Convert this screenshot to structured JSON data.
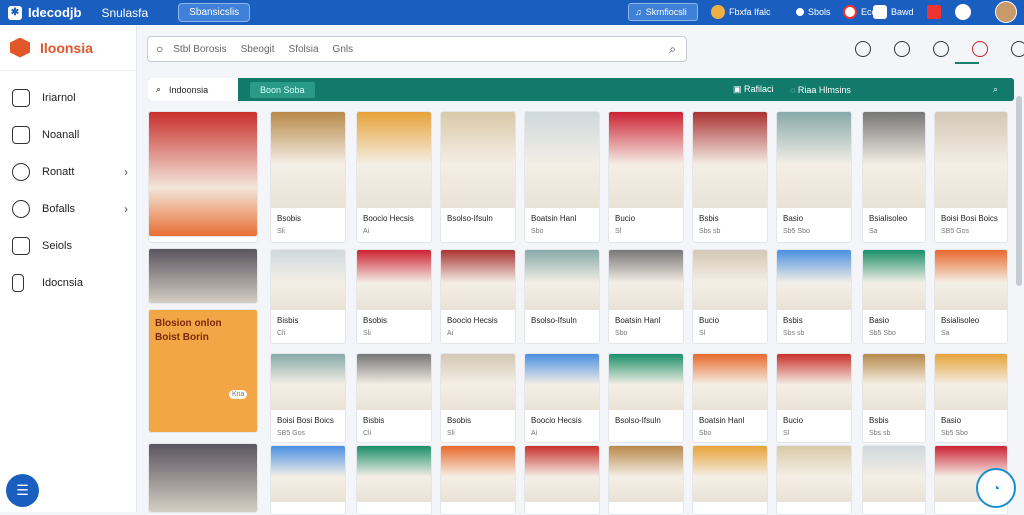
{
  "topbar": {
    "brand": "Idecodjb",
    "nav1": "Snulasfa",
    "pill": "Sbansicslis",
    "music": "Skrnfiocsli",
    "items": [
      "Fbxfa Ifalc",
      "Sbols",
      "Ecco",
      "Bawd"
    ]
  },
  "sidebar": {
    "shop_name": "Iloonsia",
    "items": [
      {
        "label": "Iriarnol",
        "icon": "route-icon",
        "chev": false
      },
      {
        "label": "Noanall",
        "icon": "chart-icon",
        "chev": false
      },
      {
        "label": "Ronatt",
        "icon": "star-icon",
        "chev": true
      },
      {
        "label": "Bofalls",
        "icon": "chat-icon",
        "chev": true
      },
      {
        "label": "Seiols",
        "icon": "list-icon",
        "chev": false
      },
      {
        "label": "Idocnsia",
        "icon": "phone-icon",
        "chev": false
      }
    ]
  },
  "search": {
    "tokens": [
      "Stbl Borosis",
      "Sbeogit",
      "Sfolsia",
      "Gnls"
    ]
  },
  "filterbar": {
    "tab1": "Indoonsia",
    "tab2": "Boon Soba",
    "right1": "Rafilaci",
    "right2": "Riaa Hlmsins"
  },
  "cards": [
    {
      "title": "Bisbis",
      "meta": "Cli"
    },
    {
      "title": "Bsobis",
      "meta": "Sli"
    },
    {
      "title": "Boocio Hecsis",
      "meta": "Ai"
    },
    {
      "title": "Bsolso-Ifsuln",
      "meta": ""
    },
    {
      "title": "Boatsin Hanl",
      "meta": "Sbo"
    },
    {
      "title": "Bucio",
      "meta": "Sl"
    },
    {
      "title": "Bsbis",
      "meta": "Sbs sb"
    },
    {
      "title": "Basio",
      "meta": "Sb5 Sbo"
    },
    {
      "title": "Bsialisoleo",
      "meta": "Sa"
    },
    {
      "title": "Boisi Bosi Boics",
      "meta": "SB5 Gos"
    }
  ],
  "promo": {
    "line1": "Blosion onlon",
    "line2": "Boist Borin",
    "badge": "Kna"
  },
  "colors": {
    "primary": "#1a5fc0",
    "teal": "#117a6b",
    "accent": "#e2572a"
  }
}
